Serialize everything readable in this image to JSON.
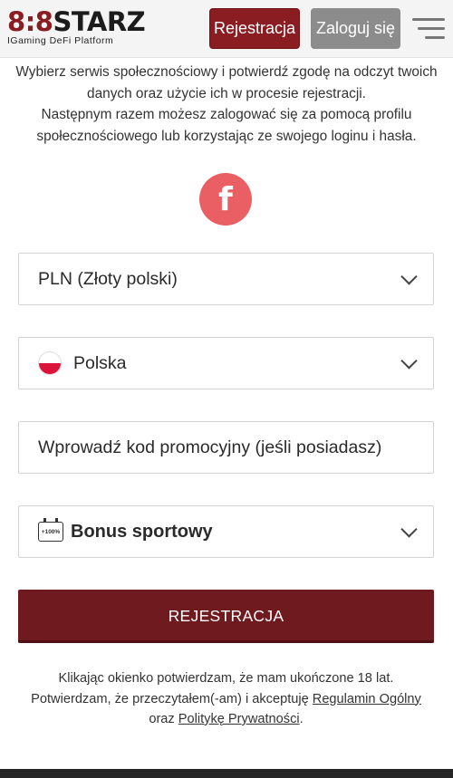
{
  "header": {
    "logo_main_num": "8",
    "logo_main_sep": ":",
    "logo_main_num2": "8",
    "logo_main_text": "STARZ",
    "logo_sub": "IGaming DeFi Platform",
    "register_label": "Rejestracja",
    "login_label": "Zaloguj się",
    "menu_icon": "hamburger-icon"
  },
  "intro": {
    "line1": "Wybierz serwis społecznościowy i potwierdź zgodę na odczyt twoich danych oraz użycie ich w procesie rejestracji.",
    "line2": "Następnym razem możesz zalogować się za pomocą profilu społecznościowego lub korzystając ze swojego loginu i hasła."
  },
  "social": {
    "facebook_glyph": "f"
  },
  "form": {
    "currency_value": "PLN (Złoty polski)",
    "country_value": "Polska",
    "promo_placeholder": "Wprowadź kod promocyjny (jeśli posiadasz)",
    "bonus_icon_text": "+100%",
    "bonus_value": "Bonus sportowy",
    "submit_label": "REJESTRACJA"
  },
  "legal": {
    "line1": "Klikając okienko potwierdzam, że mam ukończone 18 lat.",
    "line2_prefix": "Potwierdzam, że przeczytałem(-am) i akceptuję ",
    "terms_link": "Regulamin Ogólny",
    "line3_prefix": "oraz ",
    "privacy_link": "Politykę Prywatności",
    "line3_suffix": "."
  },
  "colors": {
    "brand": "#8a1d21",
    "submit": "#6f1a1e",
    "login_button": "#8c8c8c",
    "facebook": "#ea5f63"
  }
}
